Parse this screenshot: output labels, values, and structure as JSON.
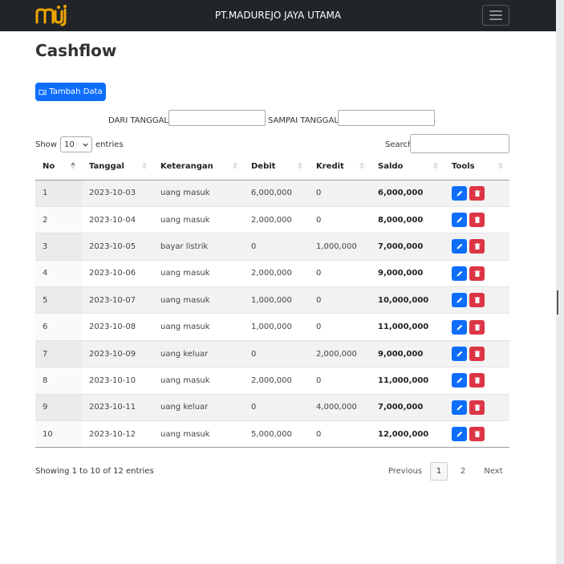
{
  "navbar": {
    "brand_logo": "mju",
    "title": "PT.MADUREJO JAYA UTAMA",
    "toggler_icon": "hamburger-icon"
  },
  "page": {
    "title": "Cashflow"
  },
  "toolbar": {
    "add_label": "Tambah Data",
    "add_icon": "add-folder-icon"
  },
  "filter": {
    "from_label": "DARI TANGGAL:",
    "to_label": "SAMPAI TANGGAL:",
    "from_value": "",
    "to_value": ""
  },
  "length_menu": {
    "show_label": "Show",
    "selected": "10",
    "entries_label": "entries"
  },
  "search": {
    "label": "Search:",
    "value": ""
  },
  "table": {
    "columns": [
      "No",
      "Tanggal",
      "Keterangan",
      "Debit",
      "Kredit",
      "Saldo",
      "Tools"
    ],
    "rows": [
      {
        "no": "1",
        "tanggal": "2023-10-03",
        "keterangan": "uang masuk",
        "debit": "6,000,000",
        "kredit": "0",
        "saldo": "6,000,000"
      },
      {
        "no": "2",
        "tanggal": "2023-10-04",
        "keterangan": "uang masuk",
        "debit": "2,000,000",
        "kredit": "0",
        "saldo": "8,000,000"
      },
      {
        "no": "3",
        "tanggal": "2023-10-05",
        "keterangan": "bayar listrik",
        "debit": "0",
        "kredit": "1,000,000",
        "saldo": "7,000,000"
      },
      {
        "no": "4",
        "tanggal": "2023-10-06",
        "keterangan": "uang masuk",
        "debit": "2,000,000",
        "kredit": "0",
        "saldo": "9,000,000"
      },
      {
        "no": "5",
        "tanggal": "2023-10-07",
        "keterangan": "uang masuk",
        "debit": "1,000,000",
        "kredit": "0",
        "saldo": "10,000,000"
      },
      {
        "no": "6",
        "tanggal": "2023-10-08",
        "keterangan": "uang masuk",
        "debit": "1,000,000",
        "kredit": "0",
        "saldo": "11,000,000"
      },
      {
        "no": "7",
        "tanggal": "2023-10-09",
        "keterangan": "uang keluar",
        "debit": "0",
        "kredit": "2,000,000",
        "saldo": "9,000,000"
      },
      {
        "no": "8",
        "tanggal": "2023-10-10",
        "keterangan": "uang masuk",
        "debit": "2,000,000",
        "kredit": "0",
        "saldo": "11,000,000"
      },
      {
        "no": "9",
        "tanggal": "2023-10-11",
        "keterangan": "uang keluar",
        "debit": "0",
        "kredit": "4,000,000",
        "saldo": "7,000,000"
      },
      {
        "no": "10",
        "tanggal": "2023-10-12",
        "keterangan": "uang masuk",
        "debit": "5,000,000",
        "kredit": "0",
        "saldo": "12,000,000"
      }
    ],
    "tool_icons": [
      "edit-pencil-icon",
      "delete-trash-icon"
    ]
  },
  "footer": {
    "info": "Showing 1 to 10 of 12 entries",
    "previous_label": "Previous",
    "pages": [
      "1",
      "2"
    ],
    "current_page": "1",
    "next_label": "Next"
  },
  "colors": {
    "navbar_bg": "#212529",
    "primary": "#0d6efd",
    "danger": "#dc3545"
  }
}
